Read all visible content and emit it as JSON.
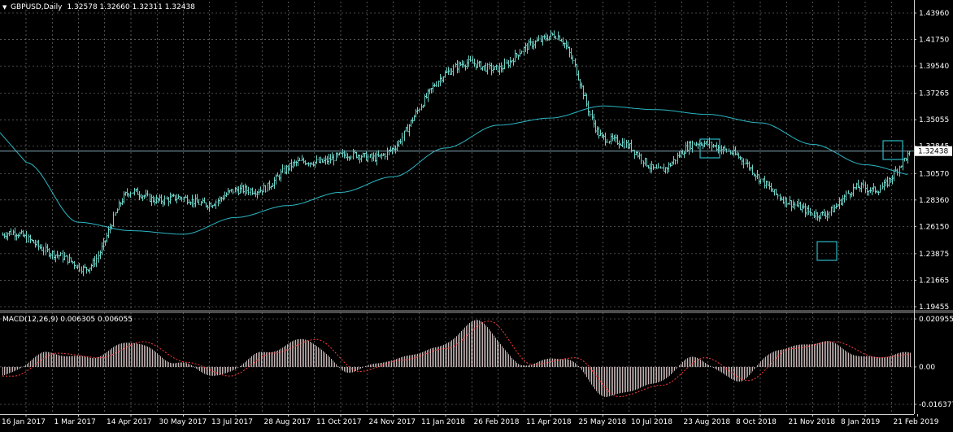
{
  "window": {
    "symbol_label": "GBPUSD,Daily",
    "ohlc": "1.32578 1.32660 1.32311 1.32438",
    "dropdown_icon": "triangle-down-icon"
  },
  "colors": {
    "background": "#000000",
    "grid": "#8a8a8a",
    "candle": "#6fd3c8",
    "ma_line": "#2bb7c4",
    "price_line": "#7fa8b4",
    "price_tag_bg": "#ffffff",
    "price_tag_text": "#000000",
    "histogram": "#c9b9b9",
    "signal_line": "#ff3b3b",
    "marker_box": "#2bb7c4",
    "text": "#ffffff"
  },
  "price_panel": {
    "y_ticks": [
      "1.43960",
      "1.41750",
      "1.39540",
      "1.37265",
      "1.35055",
      "1.32845",
      "1.30570",
      "1.28360",
      "1.26150",
      "1.23875",
      "1.21665",
      "1.19455"
    ],
    "current_price_tag": "1.32438"
  },
  "macd_panel": {
    "label": "MACD(12,26,9) 0.006305 0.006055",
    "y_ticks": [
      "0.020955",
      "0.00",
      "-0.016377"
    ]
  },
  "time_axis": {
    "labels": [
      "16 Jan 2017",
      "1 Mar 2017",
      "14 Apr 2017",
      "30 May 2017",
      "13 Jul 2017",
      "28 Aug 2017",
      "11 Oct 2017",
      "24 Nov 2017",
      "11 Jan 2018",
      "26 Feb 2018",
      "11 Apr 2018",
      "25 May 2018",
      "10 Jul 2018",
      "23 Aug 2018",
      "8 Oct 2018",
      "21 Nov 2018",
      "8 Jan 2019",
      "21 Feb 2019"
    ]
  },
  "chart_data": {
    "type": "line",
    "title": "GBPUSD,Daily",
    "x": [
      "16 Jan 2017",
      "1 Mar 2017",
      "14 Apr 2017",
      "30 May 2017",
      "13 Jul 2017",
      "28 Aug 2017",
      "11 Oct 2017",
      "24 Nov 2017",
      "11 Jan 2018",
      "26 Feb 2018",
      "11 Apr 2018",
      "25 May 2018",
      "10 Jul 2018",
      "23 Aug 2018",
      "8 Oct 2018",
      "21 Nov 2018",
      "8 Jan 2019",
      "21 Feb 2019"
    ],
    "series": [
      {
        "name": "GBPUSD",
        "values": [
          1.245,
          1.228,
          1.289,
          1.276,
          1.294,
          1.305,
          1.318,
          1.332,
          1.385,
          1.4,
          1.425,
          1.335,
          1.318,
          1.328,
          1.302,
          1.275,
          1.285,
          1.324
        ]
      },
      {
        "name": "MA",
        "values": [
          1.315,
          1.265,
          1.258,
          1.255,
          1.269,
          1.279,
          1.29,
          1.303,
          1.327,
          1.346,
          1.352,
          1.362,
          1.359,
          1.355,
          1.348,
          1.33,
          1.313,
          1.304
        ]
      }
    ],
    "ylim": [
      1.19455,
      1.4396
    ],
    "macd": {
      "label": "MACD(12,26,9)",
      "main": 0.006305,
      "signal": 0.006055,
      "ylim": [
        -0.016377,
        0.020955
      ],
      "histogram": [
        -0.004,
        0.006,
        0.004,
        0.011,
        0.002,
        -0.004,
        0.006,
        0.012,
        -0.002,
        0.003,
        0.008,
        0.02,
        0.001,
        0.004,
        -0.013,
        -0.008,
        0.004,
        -0.006,
        0.008,
        0.011,
        0.004,
        0.006
      ]
    }
  }
}
